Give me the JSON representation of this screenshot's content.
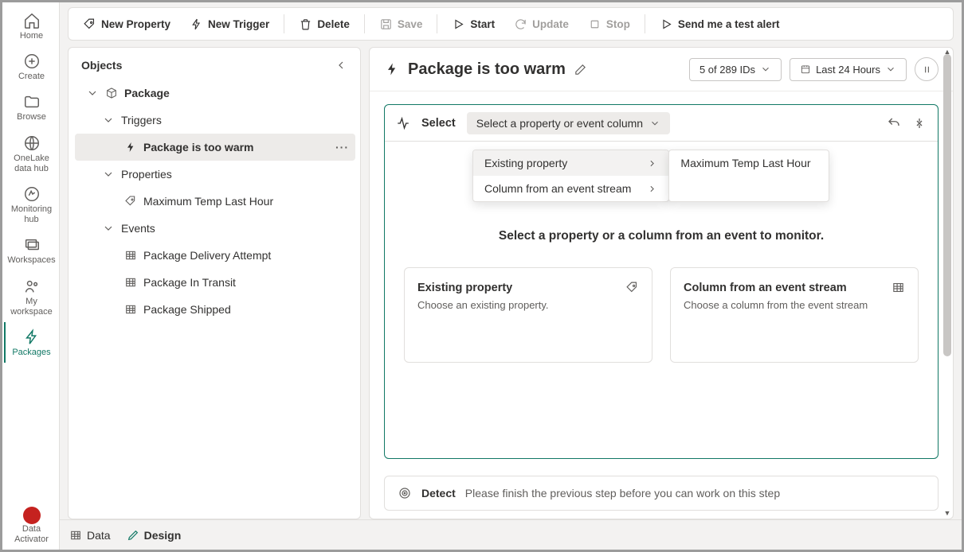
{
  "rail": {
    "items": [
      {
        "label": "Home"
      },
      {
        "label": "Create"
      },
      {
        "label": "Browse"
      },
      {
        "label": "OneLake data hub"
      },
      {
        "label": "Monitoring hub"
      },
      {
        "label": "Workspaces"
      },
      {
        "label": "My workspace"
      },
      {
        "label": "Packages"
      }
    ],
    "bottom": {
      "label": "Data Activator"
    }
  },
  "toolbar": {
    "new_property": "New Property",
    "new_trigger": "New Trigger",
    "delete": "Delete",
    "save": "Save",
    "start": "Start",
    "update": "Update",
    "stop": "Stop",
    "send_test": "Send me a test alert"
  },
  "objects": {
    "title": "Objects",
    "package": "Package",
    "triggers": "Triggers",
    "trigger1": "Package is too warm",
    "properties": "Properties",
    "prop1": "Maximum Temp Last Hour",
    "events": "Events",
    "ev1": "Package Delivery Attempt",
    "ev2": "Package In Transit",
    "ev3": "Package Shipped"
  },
  "detail": {
    "title": "Package is too warm",
    "ids_label": "5 of 289 IDs",
    "time_label": "Last 24 Hours",
    "select_label": "Select",
    "dropdown_label": "Select a property or event column",
    "placeholder": "Select a property or a column from an event to monitor.",
    "card1_title": "Existing property",
    "card1_desc": "Choose an existing property.",
    "card2_title": "Column from an event stream",
    "card2_desc": "Choose a column from the event stream",
    "fly_existing": "Existing property",
    "fly_column": "Column from an event stream",
    "fly_prop1": "Maximum Temp Last Hour",
    "detect_label": "Detect",
    "detect_msg": "Please finish the previous step before you can work on this step"
  },
  "footer": {
    "data": "Data",
    "design": "Design"
  }
}
